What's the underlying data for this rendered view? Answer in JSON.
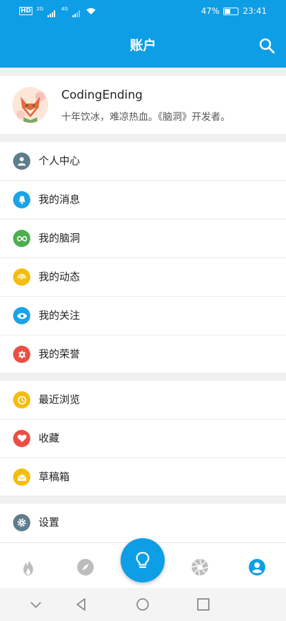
{
  "status_bar": {
    "network_left": "HD",
    "net_tag_1": "2G",
    "net_tag_2": "4G",
    "battery": "47%",
    "time": "23:41"
  },
  "app_bar": {
    "title": "账户",
    "search_icon": "search-icon"
  },
  "profile": {
    "username": "CodingEnding",
    "bio": "十年饮冰，难凉热血。《脑洞》开发者。"
  },
  "menu_group_1": [
    {
      "label": "个人中心",
      "icon": "person-icon",
      "color": "#5f7d8c"
    },
    {
      "label": "我的消息",
      "icon": "bell-icon",
      "color": "#1aa3e8"
    },
    {
      "label": "我的脑洞",
      "icon": "infinity-icon",
      "color": "#4caf50"
    },
    {
      "label": "我的动态",
      "icon": "signal-icon",
      "color": "#f4bd0d"
    },
    {
      "label": "我的关注",
      "icon": "eye-icon",
      "color": "#1aa3e8"
    },
    {
      "label": "我的荣誉",
      "icon": "badge-icon",
      "color": "#ec4f43"
    }
  ],
  "menu_group_2": [
    {
      "label": "最近浏览",
      "icon": "history-icon",
      "color": "#f4bd0d"
    },
    {
      "label": "收藏",
      "icon": "heart-icon",
      "color": "#ec4f43"
    },
    {
      "label": "草稿箱",
      "icon": "drafts-icon",
      "color": "#f4bd0d"
    }
  ],
  "menu_group_3": [
    {
      "label": "设置",
      "icon": "gear-icon",
      "color": "#5f7d8c"
    }
  ],
  "bottom_nav": {
    "items": [
      "flame-icon",
      "compass-icon",
      "bulb-icon",
      "aperture-icon",
      "account-icon"
    ],
    "active": "account-icon",
    "accent": "#0e9ee6"
  },
  "colors": {
    "primary": "#0e9ee6",
    "background": "#f0f0f0"
  }
}
